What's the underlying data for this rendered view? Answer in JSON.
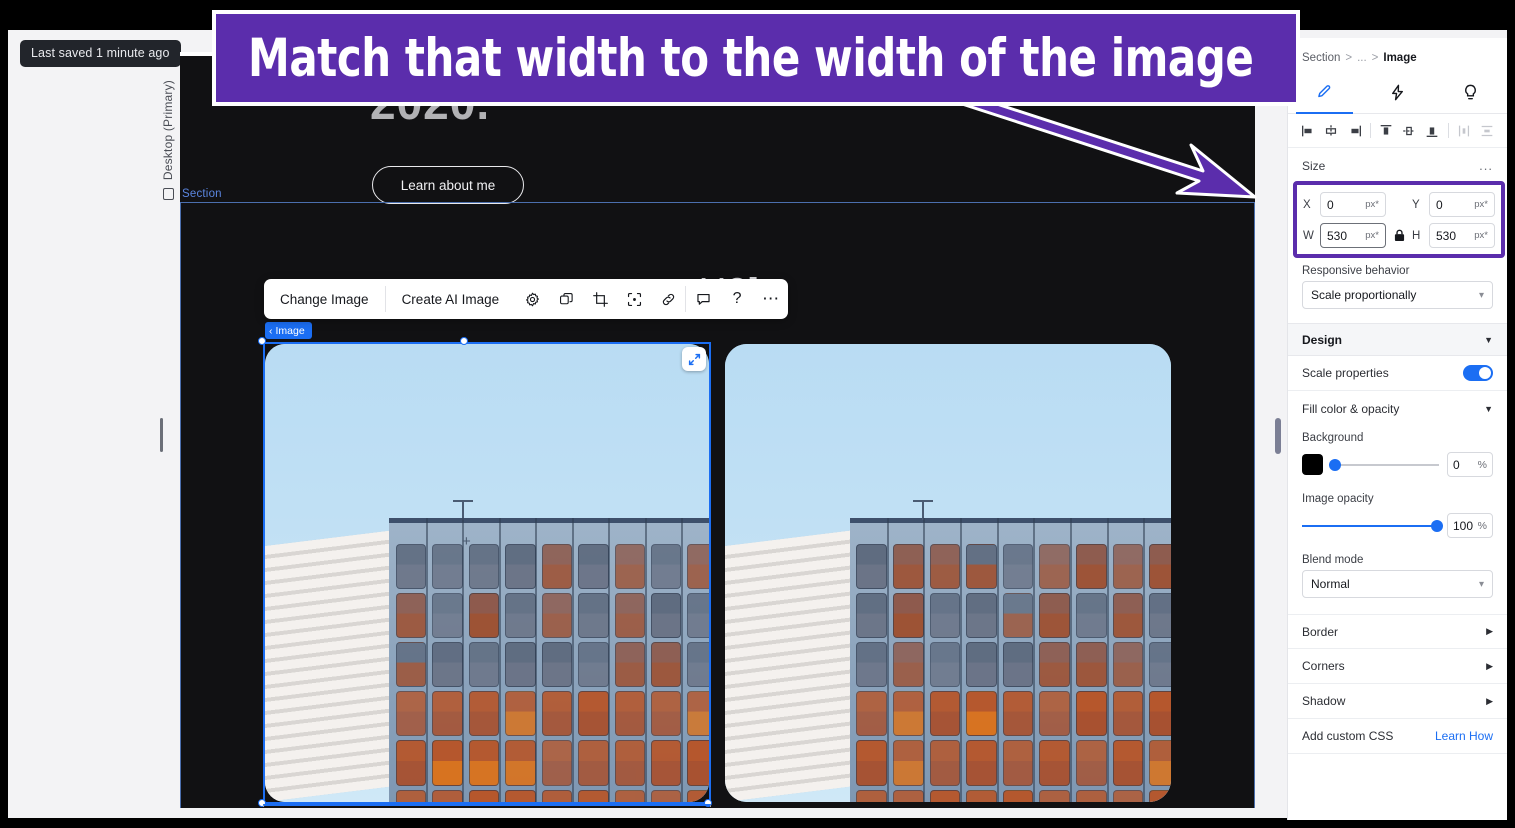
{
  "app": {
    "saved_status": "Last saved 1 minute ago",
    "device_label": "Desktop (Primary)",
    "device_icon": "monitor-icon"
  },
  "annotation": {
    "banner_text": "Match that width to the width of the image",
    "banner_color": "#5B2DAC",
    "arrow_color": "#5B2DAC",
    "arrow_outline": "#FFFFFF"
  },
  "canvas": {
    "hero_cut_text": "2020.",
    "cta_button": "Learn about me",
    "section_label": "Section",
    "background_word": "LIO]",
    "selection_badge": "Image",
    "selection_badge_chevron": "chevron-left-icon",
    "expand_icon": "expand-diagonal-icon",
    "rotate_icon": "rotate-reset-icon",
    "focal_point_icon": "crosshair-plus-icon",
    "selection_color": "#1B6EF3"
  },
  "toolbar": {
    "change_image": "Change Image",
    "create_ai_image": "Create AI Image",
    "icons": [
      {
        "name": "settings-gear-icon",
        "glyph": "gear"
      },
      {
        "name": "duplicate-layers-icon",
        "glyph": "layers"
      },
      {
        "name": "crop-icon",
        "glyph": "crop"
      },
      {
        "name": "focal-point-icon",
        "glyph": "focal"
      },
      {
        "name": "link-icon",
        "glyph": "link"
      },
      {
        "name": "comment-icon",
        "glyph": "comment"
      },
      {
        "name": "help-icon",
        "glyph": "help"
      },
      {
        "name": "more-options-icon",
        "glyph": "more"
      }
    ]
  },
  "panel": {
    "breadcrumb": {
      "root": "Section",
      "sep": ">",
      "ellipsis": "...",
      "current": "Image"
    },
    "tabs": [
      {
        "name": "tab-design",
        "icon": "paintbrush-icon",
        "active": true
      },
      {
        "name": "tab-interactions",
        "icon": "lightning-bolt-icon",
        "active": false
      },
      {
        "name": "tab-insights",
        "icon": "lightbulb-icon",
        "active": false
      }
    ],
    "align_icons": [
      "align-left-icon",
      "align-center-horizontal-icon",
      "align-right-icon",
      "align-top-icon",
      "align-middle-vertical-icon",
      "align-bottom-icon",
      "distribute-horizontal-icon",
      "distribute-vertical-icon"
    ],
    "size": {
      "heading": "Size",
      "more_label": "...",
      "x_label": "X",
      "x_value": "0",
      "x_unit": "px*",
      "y_label": "Y",
      "y_value": "0",
      "y_unit": "px*",
      "w_label": "W",
      "w_value": "530",
      "w_unit": "px*",
      "h_label": "H",
      "h_value": "530",
      "h_unit": "px*",
      "lock_icon": "lock-closed-icon",
      "highlight_color": "#5B2DAC"
    },
    "responsive": {
      "label": "Responsive behavior",
      "value": "Scale proportionally",
      "chevron": "chevron-down-icon"
    },
    "design": {
      "heading": "Design",
      "collapse_icon": "caret-down-icon",
      "scale_properties_label": "Scale properties",
      "scale_properties_on": true,
      "fill_section_label": "Fill color & opacity",
      "fill_collapse_icon": "caret-down-icon",
      "background_label": "Background",
      "background_color": "#000000",
      "background_opacity": "0",
      "background_opacity_unit": "%",
      "image_opacity_label": "Image opacity",
      "image_opacity": "100",
      "image_opacity_unit": "%",
      "blend_mode_label": "Blend mode",
      "blend_mode_value": "Normal",
      "blend_mode_chevron": "chevron-down-icon"
    },
    "collapsed_rows": [
      {
        "label": "Border",
        "icon": "caret-right-icon"
      },
      {
        "label": "Corners",
        "icon": "caret-right-icon"
      },
      {
        "label": "Shadow",
        "icon": "caret-right-icon"
      }
    ],
    "custom_css": {
      "label": "Add custom CSS",
      "link": "Learn How"
    }
  }
}
